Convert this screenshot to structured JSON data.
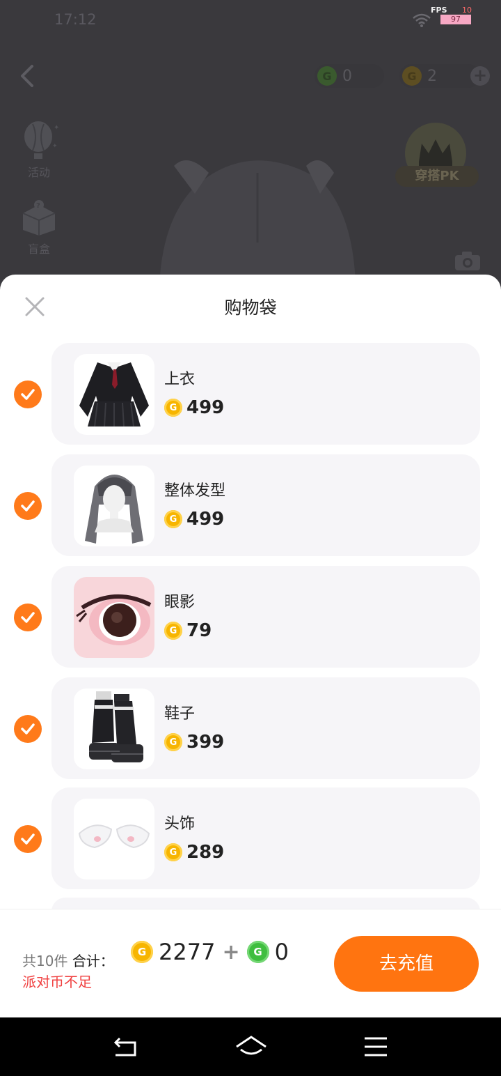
{
  "status_bar": {
    "time": "17:12",
    "fps_label": "FPS",
    "fps_value": "10",
    "fps_box": "97"
  },
  "top_bar": {
    "currency_a": {
      "icon": "green-g-coin-icon",
      "value": "0"
    },
    "currency_b": {
      "icon": "gold-g-coin-icon",
      "value": "2"
    }
  },
  "side_menu": [
    {
      "label": "活动",
      "icon": "balloon-icon"
    },
    {
      "label": "盲盒",
      "icon": "blind-box-icon"
    }
  ],
  "pk_badge": {
    "label": "穿搭PK"
  },
  "sheet": {
    "title": "购物袋",
    "items": [
      {
        "name": "上衣",
        "price": "499",
        "checked": true,
        "thumb": "jacket-skirt"
      },
      {
        "name": "整体发型",
        "price": "499",
        "checked": true,
        "thumb": "hairstyle"
      },
      {
        "name": "眼影",
        "price": "79",
        "checked": true,
        "thumb": "eyeshadow"
      },
      {
        "name": "鞋子",
        "price": "399",
        "checked": true,
        "thumb": "shoes"
      },
      {
        "name": "头饰",
        "price": "289",
        "checked": true,
        "thumb": "cat-ears"
      }
    ]
  },
  "footer": {
    "count": "共10件",
    "total_label": "合计：",
    "gold_total": "2277",
    "plus": "+",
    "green_total": "0",
    "warning": "派对币不足",
    "recharge_button": "去充值"
  },
  "colors": {
    "accent": "#ff7410",
    "check": "#ff7a1a",
    "warning": "#f04040",
    "gold_coin": "#f7b500",
    "green_coin": "#3fbe3f"
  }
}
